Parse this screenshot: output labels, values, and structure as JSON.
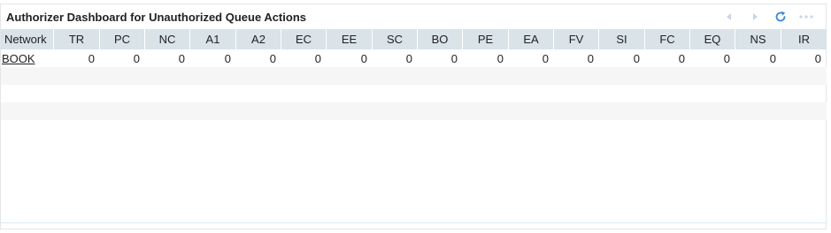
{
  "panel": {
    "title": "Authorizer Dashboard for Unauthorized Queue Actions"
  },
  "toolbar": {
    "prev_icon": "chevron-left-icon",
    "next_icon": "chevron-right-icon",
    "refresh_icon": "refresh-icon",
    "more_icon": "more-horizontal-icon",
    "accent_color": "#3a87d6",
    "disabled_color": "#c5d7ea"
  },
  "table": {
    "columns": [
      "Network",
      "TR",
      "PC",
      "NC",
      "A1",
      "A2",
      "EC",
      "EE",
      "SC",
      "BO",
      "PE",
      "EA",
      "FV",
      "SI",
      "FC",
      "EQ",
      "NS",
      "IR"
    ],
    "rows": [
      {
        "network": "BOOK",
        "values": [
          "0",
          "0",
          "0",
          "0",
          "0",
          "0",
          "0",
          "0",
          "0",
          "0",
          "0",
          "0",
          "0",
          "0",
          "0",
          "0",
          "0"
        ]
      }
    ]
  }
}
